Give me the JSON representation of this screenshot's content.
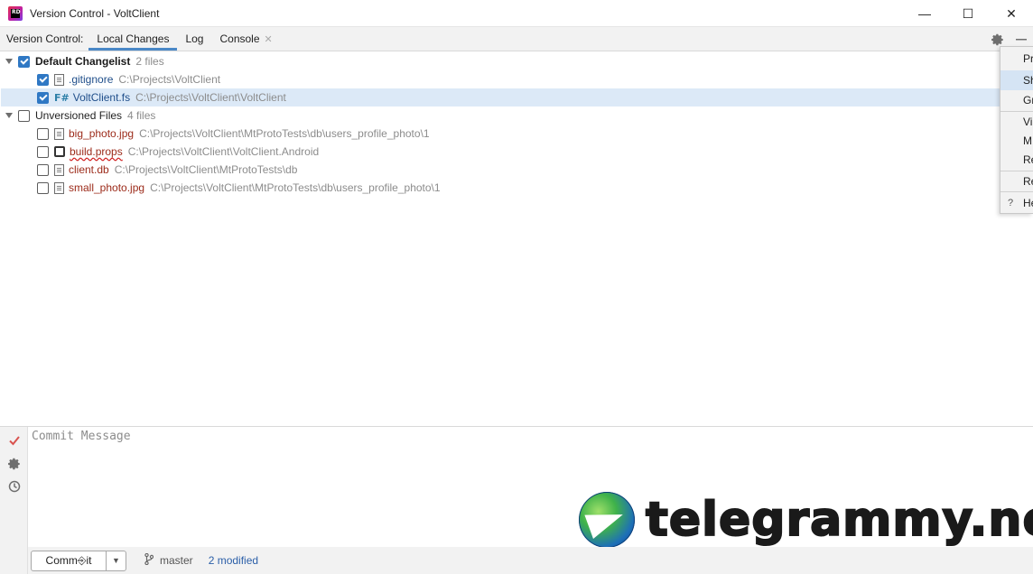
{
  "window": {
    "title": "Version Control - VoltClient",
    "logo_text": "RD",
    "minimize": "—",
    "maximize": "☐",
    "close": "✕"
  },
  "toolbar": {
    "prefix": "Version Control:",
    "tabs": [
      {
        "label": "Local Changes",
        "active": true
      },
      {
        "label": "Log",
        "active": false
      },
      {
        "label": "Console",
        "active": false,
        "closable": true
      }
    ],
    "tab_close_glyph": "✕",
    "gear_icon": "gear-icon",
    "hide_icon": "minimize-icon"
  },
  "changes": {
    "default_changelist": {
      "name": "Default Changelist",
      "count": "2 files",
      "files": [
        {
          "name": ".gitignore",
          "path": "C:\\Projects\\VoltClient",
          "checked": true
        },
        {
          "name": "VoltClient.fs",
          "path": "C:\\Projects\\VoltClient\\VoltClient",
          "checked": true,
          "prefix": "F#"
        }
      ]
    },
    "unversioned": {
      "name": "Unversioned Files",
      "count": "4 files",
      "files": [
        {
          "name": "big_photo.jpg",
          "path": "C:\\Projects\\VoltClient\\MtProtoTests\\db\\users_profile_photo\\1",
          "checked": false
        },
        {
          "name": "build.props",
          "path": "C:\\Projects\\VoltClient\\VoltClient.Android",
          "checked": false
        },
        {
          "name": "client.db",
          "path": "C:\\Projects\\VoltClient\\MtProtoTests\\db",
          "checked": false
        },
        {
          "name": "small_photo.jpg",
          "path": "C:\\Projects\\VoltClient\\MtProtoTests\\db\\users_profile_photo\\1",
          "checked": false
        }
      ]
    }
  },
  "popup_menu": {
    "items": [
      "Pr",
      "Sh",
      "Gr",
      "Vi",
      "M",
      "Re",
      "Re",
      "He"
    ],
    "help_glyph": "?"
  },
  "commit": {
    "placeholder": "Commit Message",
    "button_label": "Comm⎆it",
    "dropdown_glyph": "▼",
    "branch": "master",
    "modified": "2 modified"
  },
  "watermark": {
    "text": "telegrammy.net"
  },
  "colors": {
    "accent": "#2f78c4",
    "selection": "#dce9f7",
    "unversioned_file": "#9c2b1a",
    "versioned_file": "#1f4e8a",
    "path": "#8c8c8c"
  }
}
